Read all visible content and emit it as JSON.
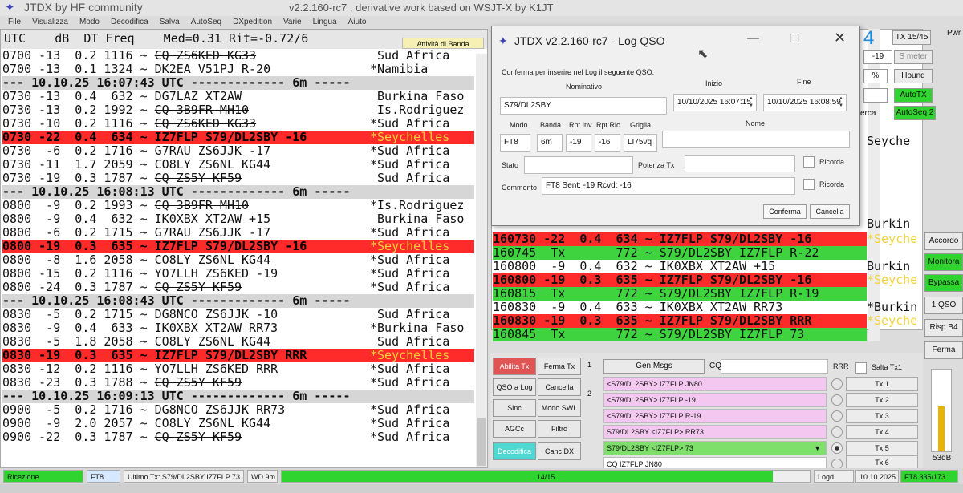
{
  "app": {
    "name": "JTDX   by HF community",
    "subtitle": "v2.2.160-rc7 , derivative work based on WSJT-X by K1JT"
  },
  "menu": [
    "File",
    "Visualizza",
    "Modo",
    "Decodifica",
    "Salva",
    "AutoSeq",
    "DXpedition",
    "Varie",
    "Lingua",
    "Aiuto"
  ],
  "band_activity": {
    "header": "UTC    dB  DT Freq    Med=0.31 Rit=-0.72/6",
    "button": "Attività di Banda",
    "rows": [
      {
        "t": "0700",
        "db": "-13",
        "dt": "0.2",
        "f": "1116",
        "msg": "~ CQ ZS6KED KG33",
        "c": " Sud Africa",
        "k": "strike"
      },
      {
        "t": "0700",
        "db": "-13",
        "dt": "0.1",
        "f": "1324",
        "msg": "~ DK2EA V51PJ R-20",
        "c": "*Namibia",
        "k": ""
      },
      {
        "sep": "--- 10.10.25 16:07:43 UTC ------------- 6m -----"
      },
      {
        "t": "0730",
        "db": "-13",
        "dt": "0.4",
        "f": "632",
        "msg": "~ DG7LAZ XT2AW",
        "c": " Burkina Faso",
        "k": ""
      },
      {
        "t": "0730",
        "db": "-13",
        "dt": "0.2",
        "f": "1992",
        "msg": "~ CQ 3B9FR MH10",
        "c": " Is.Rodriguez",
        "k": "strike"
      },
      {
        "t": "0730",
        "db": "-10",
        "dt": "0.2",
        "f": "1116",
        "msg": "~ CQ ZS6KED KG33",
        "c": "*Sud Africa",
        "k": "strike"
      },
      {
        "t": "0730",
        "db": "-22",
        "dt": "0.4",
        "f": "634",
        "msg": "~ IZ7FLP S79/DL2SBY -16",
        "c": "*Seychelles",
        "k": "hl"
      },
      {
        "t": "0730",
        "db": "-6",
        "dt": "0.2",
        "f": "1716",
        "msg": "~ G7RAU ZS6JJK -17",
        "c": "*Sud Africa",
        "k": ""
      },
      {
        "t": "0730",
        "db": "-11",
        "dt": "1.7",
        "f": "2059",
        "msg": "~ CO8LY ZS6NL KG44",
        "c": "*Sud Africa",
        "k": ""
      },
      {
        "t": "0730",
        "db": "-19",
        "dt": "0.3",
        "f": "1787",
        "msg": "~ CQ ZS5Y KF59",
        "c": " Sud Africa",
        "k": "strike"
      },
      {
        "sep": "--- 10.10.25 16:08:13 UTC ------------- 6m -----"
      },
      {
        "t": "0800",
        "db": "-9",
        "dt": "0.2",
        "f": "1993",
        "msg": "~ CQ 3B9FR MH10",
        "c": "*Is.Rodriguez",
        "k": "strike"
      },
      {
        "t": "0800",
        "db": "-9",
        "dt": "0.4",
        "f": "632",
        "msg": "~ IK0XBX XT2AW +15",
        "c": " Burkina Faso",
        "k": ""
      },
      {
        "t": "0800",
        "db": "-6",
        "dt": "0.2",
        "f": "1715",
        "msg": "~ G7RAU ZS6JJK -17",
        "c": "*Sud Africa",
        "k": ""
      },
      {
        "t": "0800",
        "db": "-19",
        "dt": "0.3",
        "f": "635",
        "msg": "~ IZ7FLP S79/DL2SBY -16",
        "c": "*Seychelles",
        "k": "hl"
      },
      {
        "t": "0800",
        "db": "-8",
        "dt": "1.6",
        "f": "2058",
        "msg": "~ CO8LY ZS6NL KG44",
        "c": "*Sud Africa",
        "k": ""
      },
      {
        "t": "0800",
        "db": "-15",
        "dt": "0.2",
        "f": "1116",
        "msg": "~ YO7LLH ZS6KED -19",
        "c": "*Sud Africa",
        "k": ""
      },
      {
        "t": "0800",
        "db": "-24",
        "dt": "0.3",
        "f": "1787",
        "msg": "~ CQ ZS5Y KF59",
        "c": "*Sud Africa",
        "k": "strike"
      },
      {
        "sep": "--- 10.10.25 16:08:43 UTC ------------- 6m -----"
      },
      {
        "t": "0830",
        "db": "-5",
        "dt": "0.2",
        "f": "1715",
        "msg": "~ DG8NCO ZS6JJK -10",
        "c": " Sud Africa",
        "k": ""
      },
      {
        "t": "0830",
        "db": "-9",
        "dt": "0.4",
        "f": "633",
        "msg": "~ IK0XBX XT2AW RR73",
        "c": "*Burkina Faso",
        "k": ""
      },
      {
        "t": "0830",
        "db": "-5",
        "dt": "1.8",
        "f": "2058",
        "msg": "~ CO8LY ZS6NL KG44",
        "c": " Sud Africa",
        "k": ""
      },
      {
        "t": "0830",
        "db": "-19",
        "dt": "0.3",
        "f": "635",
        "msg": "~ IZ7FLP S79/DL2SBY RRR",
        "c": "*Seychelles",
        "k": "hl"
      },
      {
        "t": "0830",
        "db": "-12",
        "dt": "0.2",
        "f": "1116",
        "msg": "~ YO7LLH ZS6KED RRR",
        "c": "*Sud Africa",
        "k": ""
      },
      {
        "t": "0830",
        "db": "-23",
        "dt": "0.3",
        "f": "1788",
        "msg": "~ CQ ZS5Y KF59",
        "c": "*Sud Africa",
        "k": "strike"
      },
      {
        "sep": "--- 10.10.25 16:09:13 UTC ------------- 6m -----"
      },
      {
        "t": "0900",
        "db": "-5",
        "dt": "0.2",
        "f": "1716",
        "msg": "~ DG8NCO ZS6JJK RR73",
        "c": "*Sud Africa",
        "k": ""
      },
      {
        "t": "0900",
        "db": "-9",
        "dt": "2.0",
        "f": "2057",
        "msg": "~ CO8LY ZS6NL KG44",
        "c": "*Sud Africa",
        "k": ""
      },
      {
        "t": "0900",
        "db": "-22",
        "dt": "0.3",
        "f": "1787",
        "msg": "~ CQ ZS5Y KF59",
        "c": "*Sud Africa",
        "k": "strike"
      }
    ]
  },
  "rx_freq": {
    "rows": [
      {
        "txt": "160730 -22  0.4  634 ~ IZ7FLP S79/DL2SBY -16",
        "c": "*Seyche",
        "k": "hl"
      },
      {
        "txt": "160745  Tx       772 ~ S79/DL2SBY IZ7FLP R-22",
        "c": "",
        "k": "tx"
      },
      {
        "txt": "160800  -9  0.4  632 ~ IK0XBX XT2AW +15",
        "c": "Burkin",
        "k": ""
      },
      {
        "txt": "160800 -19  0.3  635 ~ IZ7FLP S79/DL2SBY -16",
        "c": "*Seyche",
        "k": "hl"
      },
      {
        "txt": "160815  Tx       772 ~ S79/DL2SBY IZ7FLP R-19",
        "c": "",
        "k": "tx"
      },
      {
        "txt": "160830  -9  0.4  633 ~ IK0XBX XT2AW RR73",
        "c": "*Burkin",
        "k": ""
      },
      {
        "txt": "160830 -19  0.3  635 ~ IZ7FLP S79/DL2SBY RRR",
        "c": "*Seyche",
        "k": "hl"
      },
      {
        "txt": "160845  Tx       772 ~ S79/DL2SBY IZ7FLP 73",
        "c": "",
        "k": "tx"
      }
    ],
    "upper_countries": [
      "Seyche",
      "Burkin"
    ]
  },
  "top_controls": {
    "digit": "4",
    "tx_counter": "TX 15/45",
    "pwr": "Pwr",
    "meter_value": "-19",
    "s_meter": "S meter",
    "pct": "%",
    "hound": "Hound",
    "autotx": "AutoTX",
    "cerca": "erca",
    "autoseq": "AutoSeq 2"
  },
  "side_buttons": [
    "Accordo",
    "Monitora",
    "Bypassa",
    "1 QSO",
    "Risp B4",
    "Ferma"
  ],
  "dialog": {
    "title": "JTDX v2.2.160-rc7 - Log QSO",
    "prompt": "Conferma per inserire nel Log il seguente QSO:",
    "lbl_call": "Nominativo",
    "lbl_start": "Inizio",
    "lbl_end": "Fine",
    "call": "S79/DL2SBY",
    "start": "10/10/2025 16:07:15",
    "end": "10/10/2025 16:08:59",
    "lbl_mode": "Modo",
    "lbl_band": "Banda",
    "lbl_rptinv": "Rpt Inv",
    "lbl_rptric": "Rpt Ric",
    "lbl_grid": "Griglia",
    "lbl_name": "Nome",
    "mode": "FT8",
    "band": "6m",
    "rpt_sent": "-19",
    "rpt_rcvd": "-16",
    "grid": "LI75vq",
    "name": "",
    "lbl_stato": "Stato",
    "lbl_power": "Potenza Tx",
    "lbl_remember": "Ricorda",
    "lbl_comment": "Commento",
    "comment": "FT8  Sent: -19  Rcvd: -16",
    "ok": "Conferma",
    "cancel": "Cancella"
  },
  "bottom_buttons": [
    {
      "label": "Abilita Tx",
      "style": "red"
    },
    {
      "label": "Ferma Tx",
      "style": ""
    },
    {
      "label": "QSO a Log",
      "style": ""
    },
    {
      "label": "Cancella",
      "style": ""
    },
    {
      "label": "Sinc",
      "style": ""
    },
    {
      "label": "Modo SWL",
      "style": ""
    },
    {
      "label": "AGCc",
      "style": ""
    },
    {
      "label": "Filtro",
      "style": ""
    },
    {
      "label": "Decodifica",
      "style": "cyan"
    },
    {
      "label": "Canc DX",
      "style": ""
    }
  ],
  "tab_numbers": [
    "1",
    "2"
  ],
  "messages": {
    "gen": "Gen.Msgs",
    "cq_label": "CQ",
    "rrr": "RRR",
    "skip": "Salta Tx1",
    "rows": [
      {
        "txt": "<S79/DL2SBY> IZ7FLP JN80",
        "style": ""
      },
      {
        "txt": "<S79/DL2SBY> IZ7FLP -19",
        "style": ""
      },
      {
        "txt": "<S79/DL2SBY> IZ7FLP R-19",
        "style": ""
      },
      {
        "txt": "S79/DL2SBY <IZ7FLP> RR73",
        "style": ""
      },
      {
        "txt": "S79/DL2SBY <IZ7FLP> 73",
        "style": "green"
      },
      {
        "txt": "CQ IZ7FLP JN80",
        "style": "plain"
      }
    ],
    "tx": [
      "Tx 1",
      "Tx 2",
      "Tx 3",
      "Tx 4",
      "Tx 5",
      "Tx 6"
    ]
  },
  "level": {
    "label": "53dB",
    "fill": 0.55
  },
  "status": {
    "rx": "Ricezione",
    "mode": "FT8",
    "last_tx": "Ultimo Tx: S79/DL2SBY IZ7FLP 73",
    "wd": "WD 9m",
    "progress_text": "14/15",
    "progress": 0.93,
    "logd": "Logd",
    "date": "10.10.2025",
    "counter": "FT8  335/173"
  }
}
